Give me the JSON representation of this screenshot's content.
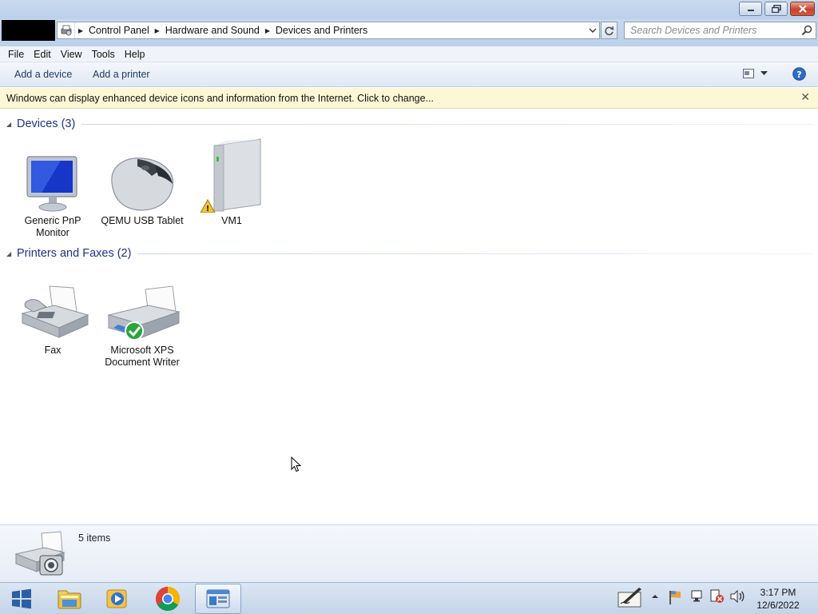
{
  "window": {
    "controls": {
      "minimize": "minimize",
      "maximize": "restore",
      "close": "close"
    }
  },
  "address": {
    "breadcrumbs": [
      "Control Panel",
      "Hardware and Sound",
      "Devices and Printers"
    ],
    "search_placeholder": "Search Devices and Printers"
  },
  "menu": [
    "File",
    "Edit",
    "View",
    "Tools",
    "Help"
  ],
  "commands": {
    "add_device": "Add a device",
    "add_printer": "Add a printer"
  },
  "infobar": {
    "text": "Windows can display enhanced device icons and information from the Internet. Click to change...",
    "close": "✕"
  },
  "groups": {
    "devices": {
      "title": "Devices (3)",
      "items": [
        {
          "label": "Generic PnP Monitor",
          "icon": "monitor-icon"
        },
        {
          "label": "QEMU USB Tablet",
          "icon": "mouse-icon"
        },
        {
          "label": "VM1",
          "icon": "computer-tower-icon",
          "status": "warning"
        }
      ]
    },
    "printers": {
      "title": "Printers and Faxes (2)",
      "items": [
        {
          "label": "Fax",
          "icon": "fax-icon"
        },
        {
          "label": "Microsoft XPS Document Writer",
          "icon": "printer-icon",
          "status": "default"
        }
      ]
    }
  },
  "details": {
    "count": "5 items"
  },
  "taskbar": {
    "items": [
      "start-button",
      "file-explorer",
      "media-player",
      "chrome",
      "devices-and-printers"
    ],
    "clock": {
      "time": "3:17 PM",
      "date": "12/6/2022"
    }
  },
  "colors": {
    "group_title": "#1e3287",
    "infobar_bg": "#fcf8d6",
    "command_text": "#1e395b"
  }
}
